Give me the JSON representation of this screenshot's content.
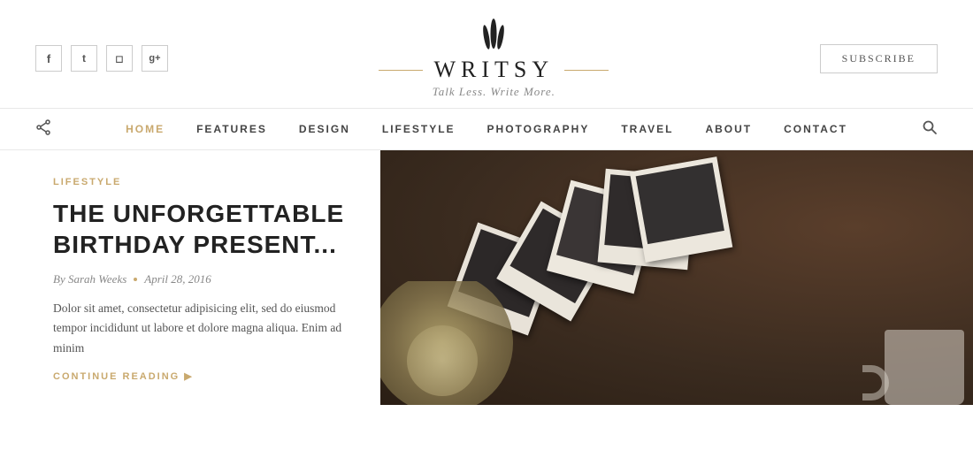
{
  "header": {
    "logo": {
      "text": "WRITSY",
      "tagline": "Talk Less. Write More."
    },
    "subscribe_label": "SUBSCRIBE"
  },
  "social": {
    "icons": [
      {
        "name": "facebook",
        "symbol": "f"
      },
      {
        "name": "twitter",
        "symbol": "t"
      },
      {
        "name": "instagram",
        "symbol": "i"
      },
      {
        "name": "google-plus",
        "symbol": "g+"
      }
    ]
  },
  "nav": {
    "items": [
      {
        "label": "HOME",
        "active": true
      },
      {
        "label": "FEATURES",
        "active": false
      },
      {
        "label": "DESIGN",
        "active": false
      },
      {
        "label": "LIFESTYLE",
        "active": false
      },
      {
        "label": "PHOTOGRAPHY",
        "active": false
      },
      {
        "label": "TRAVEL",
        "active": false
      },
      {
        "label": "ABOUT",
        "active": false
      },
      {
        "label": "CONTACT",
        "active": false
      }
    ]
  },
  "hero": {
    "category": "LIFESTYLE",
    "title": "THE UNFORGETTABLE\nBIRTHDAY PRESENT...",
    "author": "By Sarah Weeks",
    "date": "April 28, 2016",
    "excerpt": "Dolor sit amet, consectetur adipisicing elit, sed do eiusmod tempor incididunt ut labore et dolore magna aliqua. Enim ad minim",
    "read_more": "CONTINUE READING ▶"
  }
}
